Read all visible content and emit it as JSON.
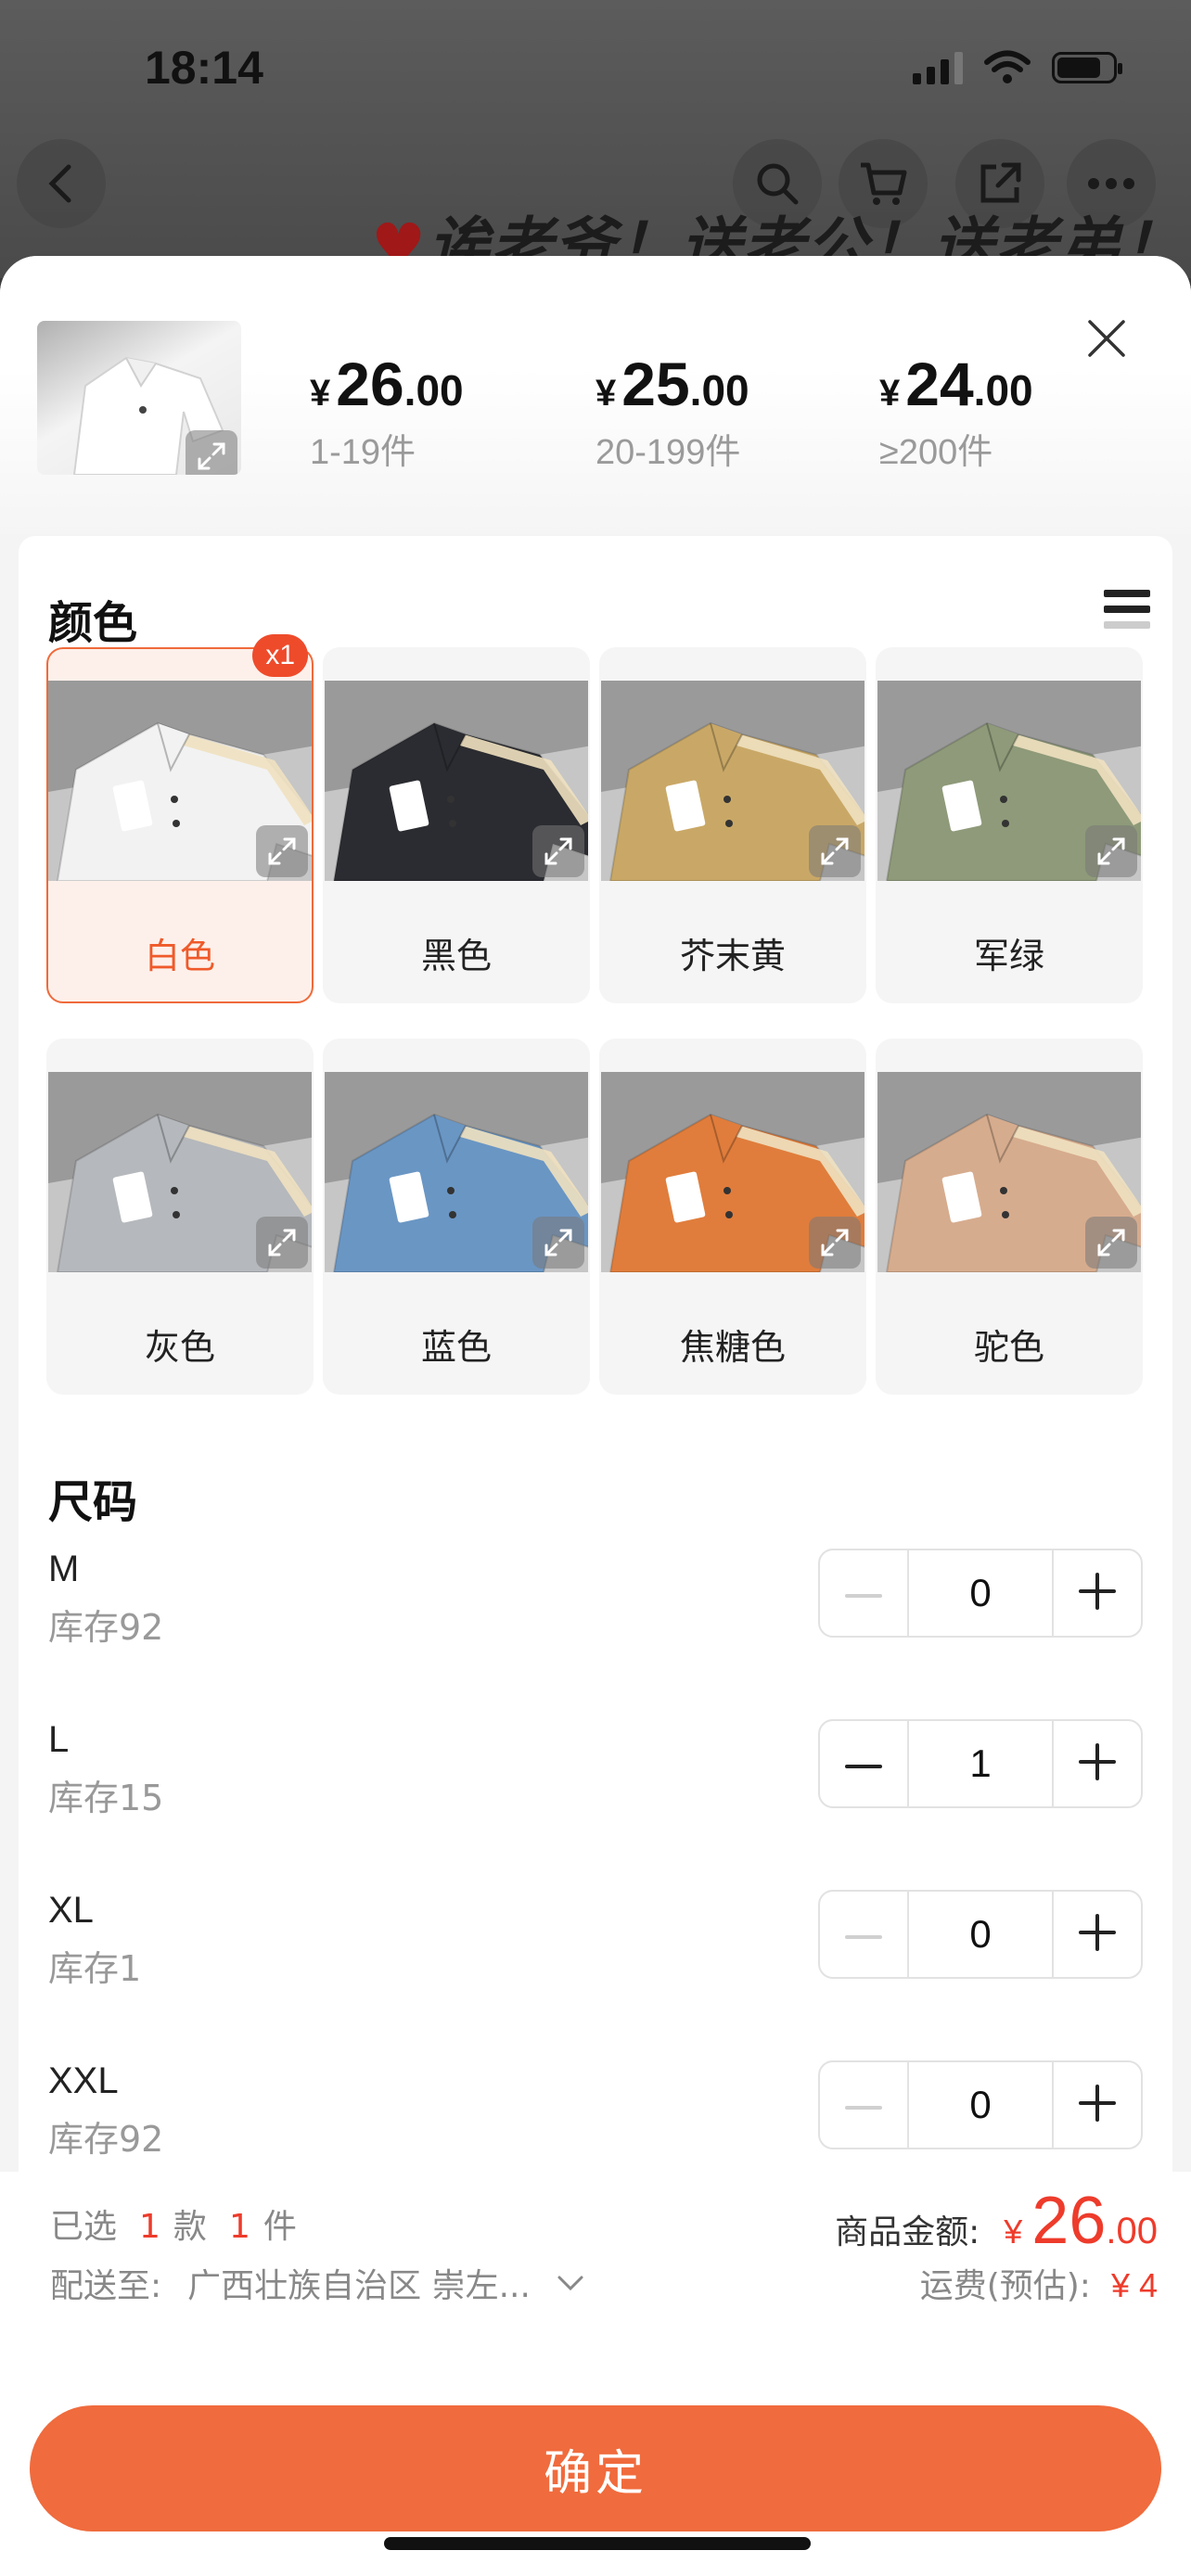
{
  "status_bar": {
    "time": "18:14",
    "signal_icon": "signal-icon",
    "wifi_icon": "wifi-icon",
    "battery_icon": "battery-icon",
    "battery_level": 0.8
  },
  "top_nav": {
    "back_icon": "chevron-left-icon",
    "search_icon": "search-icon",
    "cart_icon": "cart-icon",
    "share_icon": "share-icon",
    "more_icon": "more-icon"
  },
  "banner_text": "诶老爷！送老公！送老弟！",
  "sheet": {
    "close_icon": "close-icon",
    "price_tiers": [
      {
        "currency": "¥",
        "int": "26",
        "dec": ".00",
        "range": "1-19件"
      },
      {
        "currency": "¥",
        "int": "25",
        "dec": ".00",
        "range": "20-199件"
      },
      {
        "currency": "¥",
        "int": "24",
        "dec": ".00",
        "range": "≥200件"
      }
    ]
  },
  "color_section": {
    "title": "颜色",
    "options": [
      {
        "label": "白色",
        "badge": "x1",
        "selected": true,
        "color": "#f2f2f2"
      },
      {
        "label": "黑色",
        "color": "#2b2c31"
      },
      {
        "label": "芥末黄",
        "color": "#c9a867"
      },
      {
        "label": "军绿",
        "color": "#8e9a79"
      },
      {
        "label": "灰色",
        "color": "#b5b8bc"
      },
      {
        "label": "蓝色",
        "color": "#6a96c4"
      },
      {
        "label": "焦糖色",
        "color": "#e07d3c"
      },
      {
        "label": "驼色",
        "color": "#d6ac8e"
      }
    ]
  },
  "size_section": {
    "title": "尺码",
    "rows": [
      {
        "name": "M",
        "stock": "库存92",
        "qty": "0",
        "minus_enabled": false
      },
      {
        "name": "L",
        "stock": "库存15",
        "qty": "1",
        "minus_enabled": true
      },
      {
        "name": "XL",
        "stock": "库存1",
        "qty": "0",
        "minus_enabled": false
      },
      {
        "name": "XXL",
        "stock": "库存92",
        "qty": "0",
        "minus_enabled": false
      }
    ]
  },
  "footer": {
    "selected_prefix": "已选",
    "selected_styles": "1",
    "styles_unit": "款",
    "selected_items": "1",
    "items_unit": "件",
    "ship_label": "配送至:",
    "ship_address": "广西壮族自治区 崇左...",
    "total_label": "商品金额:",
    "total_currency": "¥",
    "total_int": "26",
    "total_dec": ".00",
    "fee_label": "运费(预估):",
    "fee_value": "¥ 4",
    "confirm_label": "确定",
    "accent_color": "#f06b3d"
  }
}
